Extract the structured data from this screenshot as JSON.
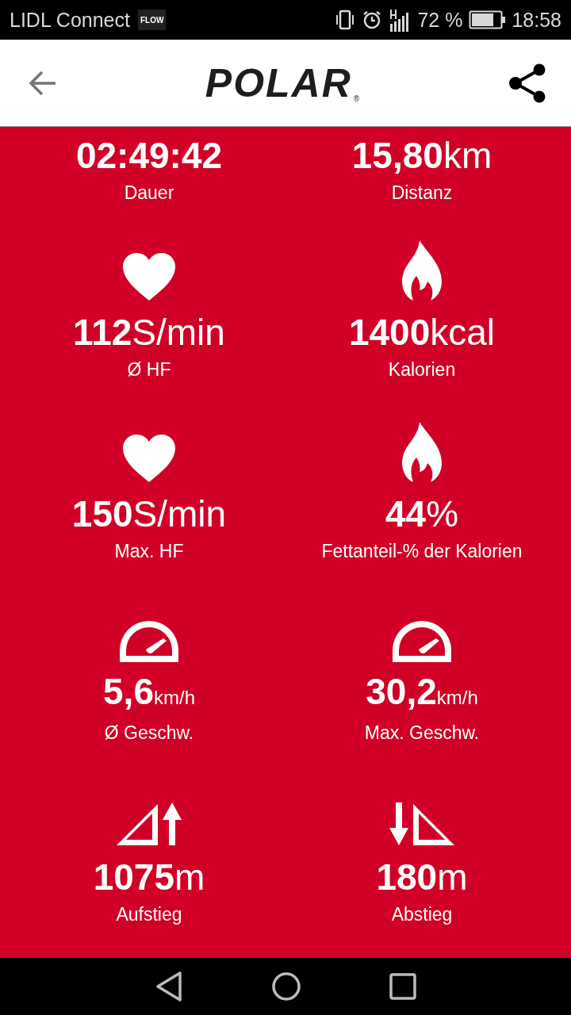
{
  "status_bar": {
    "carrier": "LIDL Connect",
    "app_badge": "FLOW",
    "battery_text": "72 %",
    "time": "18:58"
  },
  "header": {
    "logo": "POLAR",
    "registered": "®"
  },
  "stats": [
    {
      "kind": "duration",
      "value": "02:49:42",
      "label": "Dauer"
    },
    {
      "kind": "distance",
      "value": "15,80",
      "unit": "km",
      "label": "Distanz"
    },
    {
      "kind": "heart_rate",
      "value": "112",
      "unit": "S/min",
      "label": "Ø HF"
    },
    {
      "kind": "calories",
      "value": "1400",
      "unit": "kcal",
      "label": "Kalorien"
    },
    {
      "kind": "heart_rate",
      "value": "150",
      "unit": "S/min",
      "label": "Max. HF"
    },
    {
      "kind": "calories",
      "value": "44",
      "unit": "%",
      "label": "Fettanteil-% der Kalorien"
    },
    {
      "kind": "speed",
      "value": "5,6",
      "unit": "km/h",
      "label": "Ø Geschw."
    },
    {
      "kind": "speed",
      "value": "30,2",
      "unit": "km/h",
      "label": "Max. Geschw."
    },
    {
      "kind": "ascent",
      "value": "1075",
      "unit": "m",
      "label": "Aufstieg"
    },
    {
      "kind": "descent",
      "value": "180",
      "unit": "m",
      "label": "Abstieg"
    }
  ]
}
